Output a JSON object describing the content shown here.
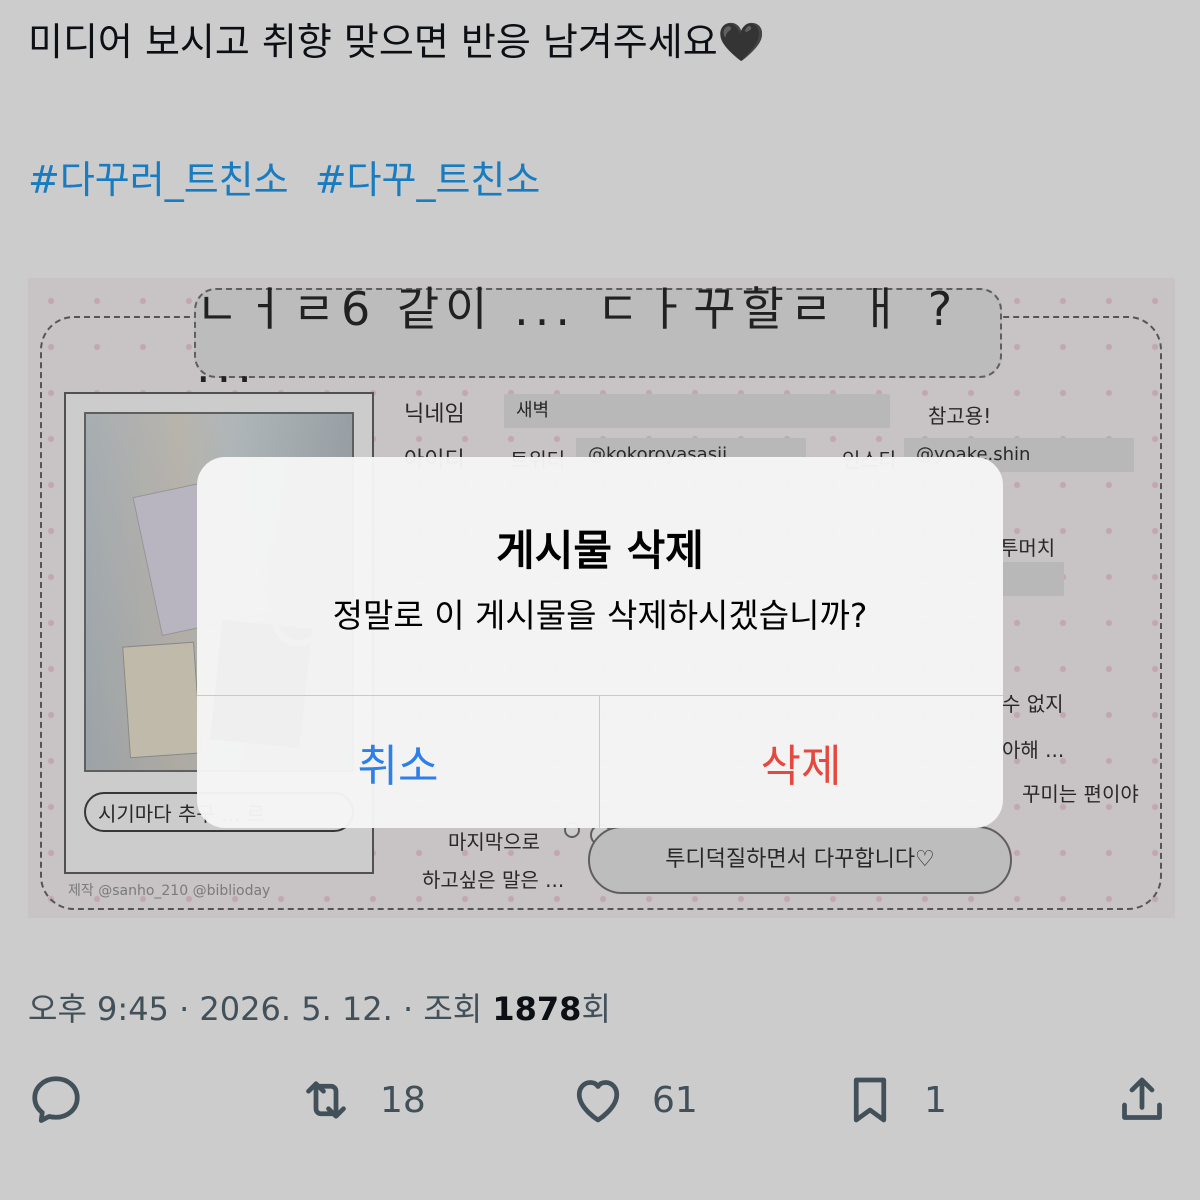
{
  "tweet": {
    "text": "미디어 보시고 취향 맞으면 반응 남겨주세요🖤",
    "hashtags": [
      "#다꾸러_트친소",
      "#다꾸_트친소"
    ]
  },
  "media": {
    "title": "ㄴㅓㄹ6 같이 ... ㄷㅏ꾸할ㄹ ㅐ ? ...",
    "labels": {
      "nickname": "닉네임",
      "id": "아이디",
      "twitter": "트위터",
      "insta": "인스타",
      "last": "마지막으로",
      "want": "하고싶은 말은 ..."
    },
    "values": {
      "nickname": "새벽",
      "twitter": "@kokoroyasasii",
      "insta": "@yoake.shin",
      "reference": "참고용!"
    },
    "notes": [
      "투머치",
      "수 없지",
      "아해 ...",
      "꾸미는 편이야"
    ],
    "speech": "시기마다 추구 ... 르",
    "cloud": "투디덕질하면서 다꾸합니다♡",
    "credit": "제작 @sanho_210  @biblioday"
  },
  "alert": {
    "title": "게시물 삭제",
    "message": "정말로 이 게시물을 삭제하시겠습니까?",
    "cancel": "취소",
    "delete": "삭제",
    "cancel_color": "#2f7fe8",
    "delete_color": "#e5483e"
  },
  "meta": {
    "time": "오후 9:45 · 2026. 5. 12. · 조회 ",
    "views": "1878",
    "views_suffix": "회"
  },
  "actions": {
    "reply": {
      "icon": "reply-icon"
    },
    "retweet": {
      "icon": "retweet-icon",
      "count": "18"
    },
    "like": {
      "icon": "heart-icon",
      "count": "61"
    },
    "bookmark": {
      "icon": "bookmark-icon",
      "count": "1"
    },
    "share": {
      "icon": "share-icon"
    }
  }
}
